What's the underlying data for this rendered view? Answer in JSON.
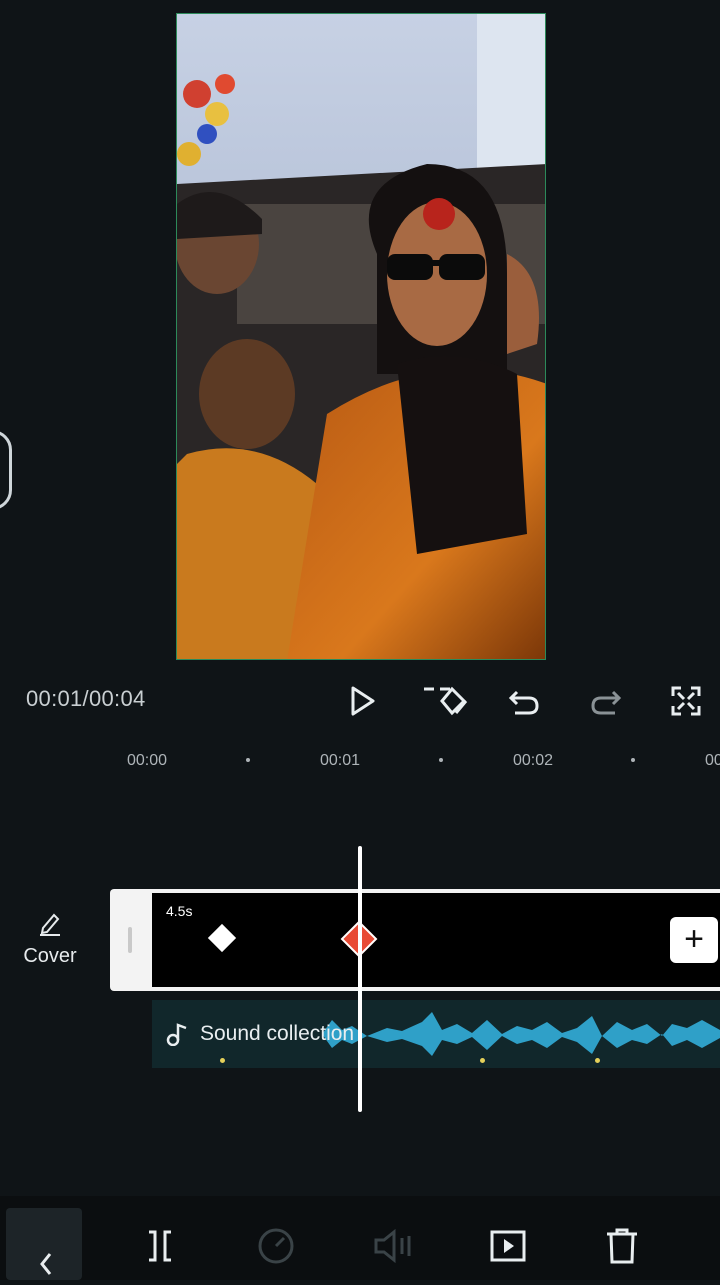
{
  "player": {
    "time_readout": "00:01/00:04",
    "controls": [
      "play-icon",
      "keyframe-icon",
      "undo-icon",
      "redo-icon",
      "fullscreen-icon"
    ]
  },
  "ruler": {
    "labels": [
      "00:00",
      "00:01",
      "00:02",
      "00"
    ]
  },
  "cover": {
    "label": "Cover",
    "icon": "pencil-icon"
  },
  "video_track": {
    "duration": "4.5s",
    "add_label": "+"
  },
  "audio_track": {
    "label": "Sound collection",
    "waveform_color": "#2fa0c8"
  },
  "colors": {
    "background": "#0f1417",
    "keyframe_active": "#e84a34",
    "track_border": "#f3f3f3"
  },
  "toolbar": {
    "items": [
      "back-icon",
      "split-icon",
      "speed-icon",
      "volume-icon",
      "animation-icon",
      "delete-icon"
    ]
  }
}
